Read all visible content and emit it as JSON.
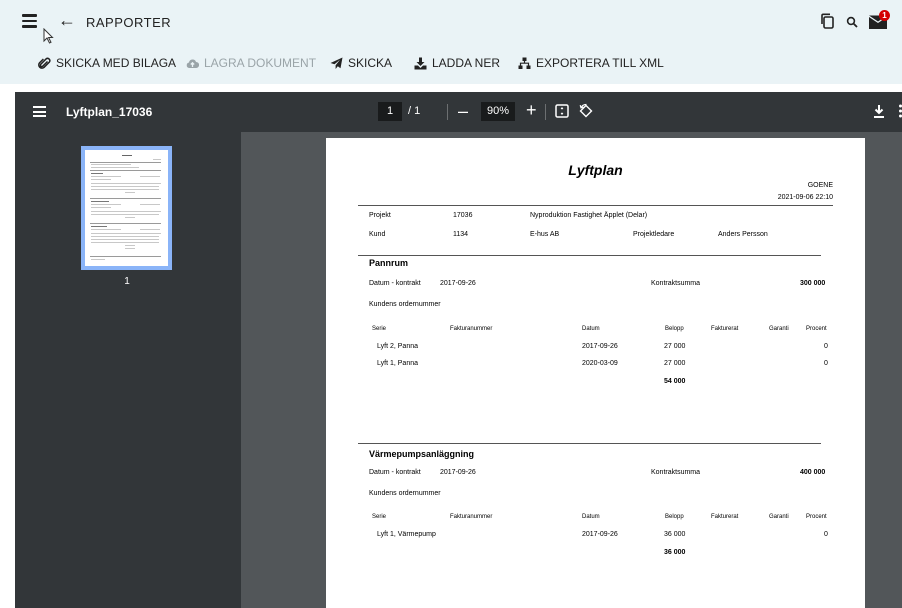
{
  "header": {
    "title": "RAPPORTER",
    "notification_count": "1",
    "actions": [
      {
        "label": "SKICKA MED BILAGA",
        "icon": "paperclip-icon",
        "enabled": true
      },
      {
        "label": "LAGRA DOKUMENT",
        "icon": "cloud-upload-icon",
        "enabled": false
      },
      {
        "label": "SKICKA",
        "icon": "send-icon",
        "enabled": true
      },
      {
        "label": "LADDA NER",
        "icon": "download-icon",
        "enabled": true
      },
      {
        "label": "EXPORTERA TILL XML",
        "icon": "sitemap-icon",
        "enabled": true
      }
    ]
  },
  "viewer": {
    "filename": "Lyftplan_17036",
    "current_page": "1",
    "total_pages": "/ 1",
    "zoom": "90%",
    "thumbnail_label": "1"
  },
  "document": {
    "title": "Lyftplan",
    "company": "GOENE",
    "date": "2021-09-06 22:10",
    "project_label": "Projekt",
    "project_number": "17036",
    "project_name": "Nyproduktion Fastighet Äpplet (Delar)",
    "customer_label": "Kund",
    "customer_number": "1134",
    "customer_name": "E-hus AB",
    "manager_label": "Projektledare",
    "manager_name": "Anders Persson",
    "columns": {
      "serie": "Serie",
      "invoice": "Fakturanummer",
      "date": "Datum",
      "amount": "Belopp",
      "invoiced": "Fakturerat",
      "guarantee": "Garanti",
      "percent": "Procent"
    },
    "sections": [
      {
        "name": "Pannrum",
        "contract_label": "Datum - kontrakt",
        "contract_date": "2017-09-26",
        "sum_label": "Kontraktsumma",
        "sum_value": "300 000",
        "order_label": "Kundens ordernummer",
        "rows": [
          {
            "serie": "Lyft 2, Panna",
            "date": "2017-09-26",
            "amount": "27 000",
            "percent": "0"
          },
          {
            "serie": "Lyft 1, Panna",
            "date": "2020-03-09",
            "amount": "27 000",
            "percent": "0"
          }
        ],
        "total": "54 000"
      },
      {
        "name": "Värmepumpsanläggning",
        "contract_label": "Datum - kontrakt",
        "contract_date": "2017-09-26",
        "sum_label": "Kontraktsumma",
        "sum_value": "400 000",
        "order_label": "Kundens ordernummer",
        "rows": [
          {
            "serie": "Lyft 1, Värmepump",
            "date": "2017-09-26",
            "amount": "36 000",
            "percent": "0"
          }
        ],
        "total": "36 000"
      }
    ]
  }
}
